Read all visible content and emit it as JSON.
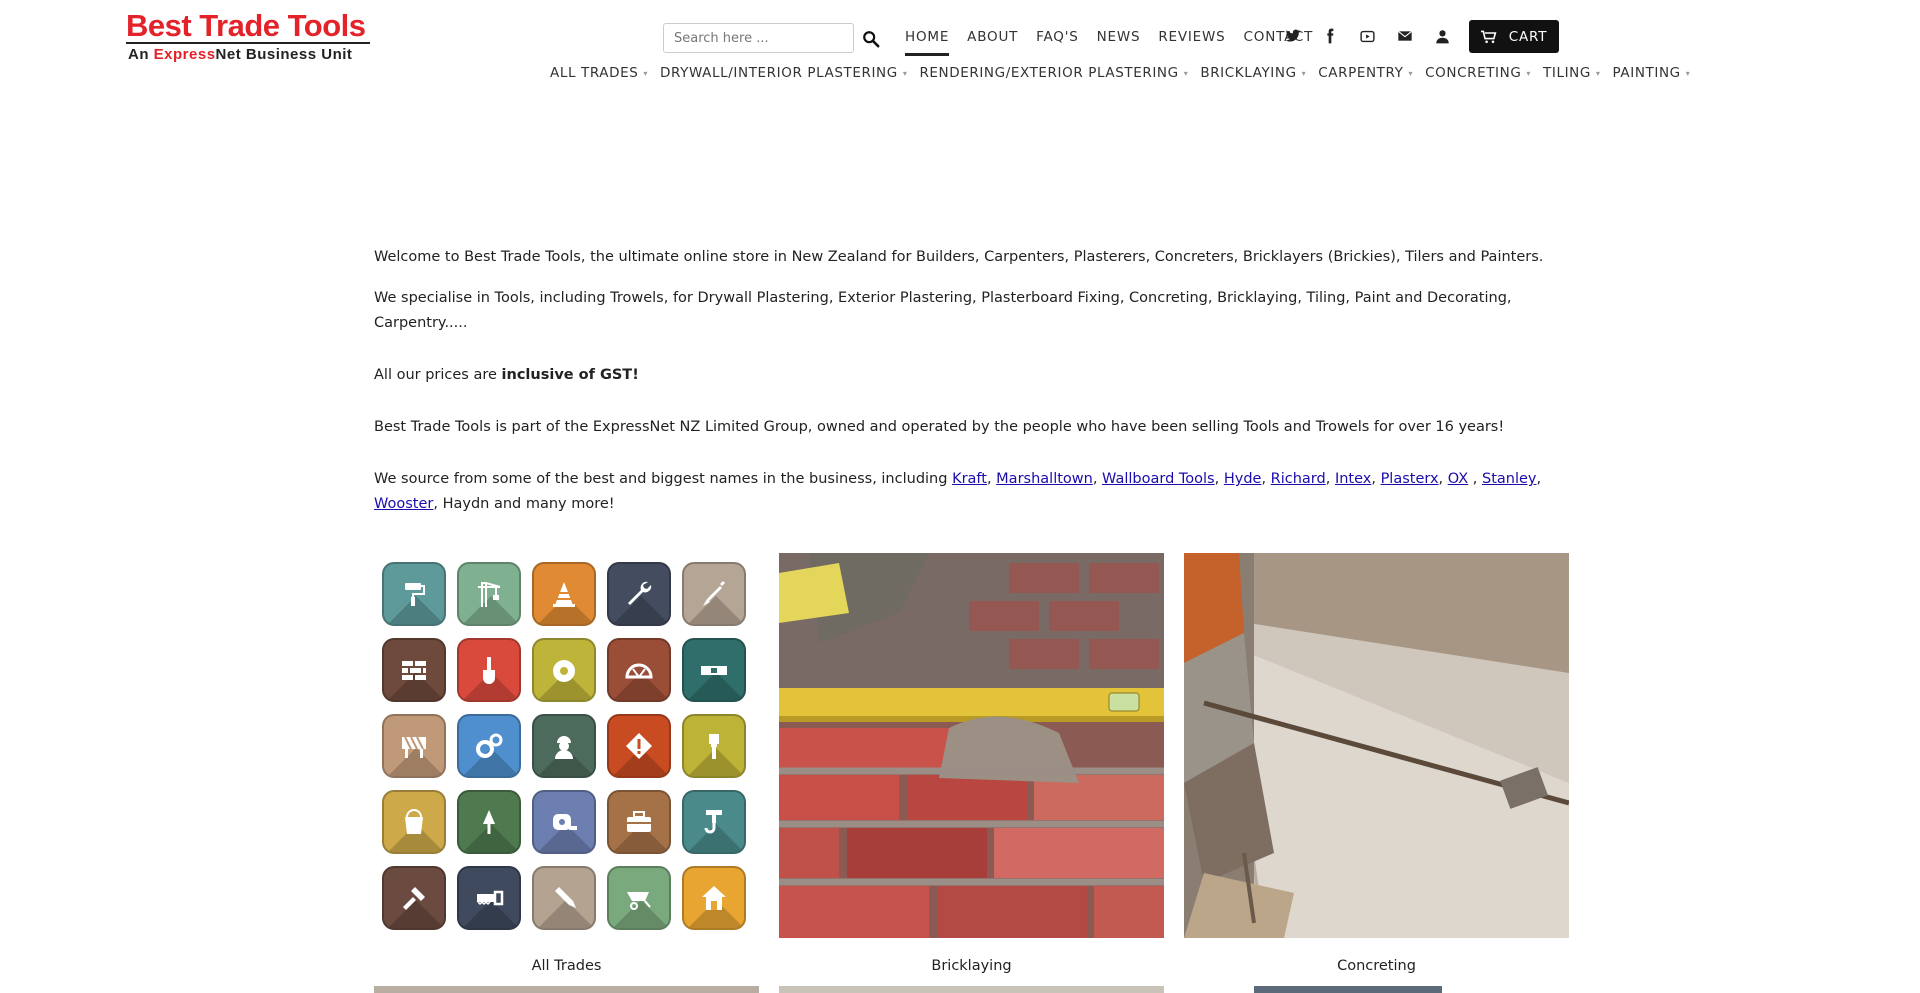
{
  "logo": {
    "part1": "Best Trade",
    "part2": "Tools",
    "sub_prefix": "An ",
    "sub_red": "Express",
    "sub_suffix": "Net Business Unit"
  },
  "search": {
    "placeholder": "Search here ..."
  },
  "topnav": [
    "HOME",
    "ABOUT",
    "FAQ'S",
    "NEWS",
    "REVIEWS",
    "CONTACT"
  ],
  "social_icons": [
    "twitter-icon",
    "facebook-icon",
    "youtube-icon",
    "email-icon",
    "account-icon"
  ],
  "cart": {
    "label": "CART"
  },
  "catnav": [
    "ALL TRADES",
    "DRYWALL/INTERIOR PLASTERING",
    "RENDERING/EXTERIOR PLASTERING",
    "BRICKLAYING",
    "CARPENTRY",
    "CONCRETING",
    "TILING",
    "PAINTING"
  ],
  "content": {
    "p1": "Welcome to Best Trade Tools, the ultimate online store in New Zealand for Builders, Carpenters, Plasterers, Concreters, Bricklayers (Brickies), Tilers and Painters.",
    "p2": "We specialise in Tools, including Trowels, for Drywall Plastering, Exterior Plastering, Plasterboard Fixing, Concreting, Bricklaying, Tiling, Paint and Decorating, Carpentry.....",
    "p3_prefix": "All our prices are ",
    "p3_bold": "inclusive of GST!",
    "p4": "Best Trade Tools is part of the ExpressNet NZ Limited Group, owned and operated by the people who have been selling Tools and Trowels for over 16 years!",
    "p5_prefix": "We source from some of the best and biggest names in the business, including ",
    "brands": [
      "Kraft",
      "Marshalltown",
      "Wallboard Tools",
      "Hyde",
      "Richard",
      "Intex",
      "Plasterx",
      "OX",
      "Stanley",
      "Wooster"
    ],
    "p5_suffix": ", Haydn and many more!"
  },
  "tiles": [
    {
      "caption": "All Trades"
    },
    {
      "caption": "Bricklaying"
    },
    {
      "caption": "Concreting"
    }
  ],
  "trade_icons": [
    "paint-roller-icon",
    "crane-icon",
    "traffic-cone-icon",
    "wrench-icon",
    "screwdriver-icon",
    "bricks-icon",
    "shovel-icon",
    "saw-blade-icon",
    "protractor-icon",
    "level-icon",
    "barrier-icon",
    "gears-icon",
    "worker-icon",
    "warning-sign-icon",
    "paintbrush-icon",
    "bucket-icon",
    "trowel-icon",
    "tape-measure-icon",
    "toolbox-icon",
    "hook-icon",
    "hammer-icon",
    "handsaw-icon",
    "chisel-icon",
    "wheelbarrow-icon",
    "house-icon"
  ],
  "trade_icon_colors": [
    "#5f9a9b",
    "#7fb08f",
    "#e08a33",
    "#444d60",
    "#b5a595",
    "#6e4a3c",
    "#d94a3d",
    "#bfb43a",
    "#9a4e37",
    "#2f6e6a",
    "#c09a78",
    "#4f8fce",
    "#4d6b5c",
    "#c94b22",
    "#bdb337",
    "#cda94a",
    "#4f7a4f",
    "#6d7fb0",
    "#a57147",
    "#4a8a8a",
    "#6b4a40",
    "#3f4a5e",
    "#b5a392",
    "#7aa97d",
    "#e8a532"
  ]
}
